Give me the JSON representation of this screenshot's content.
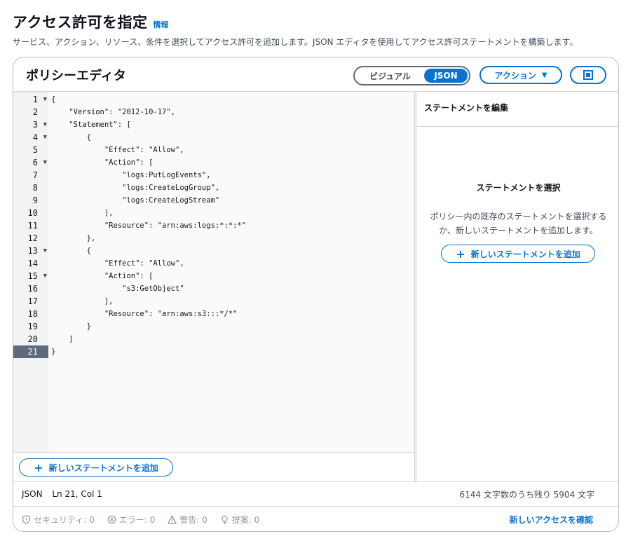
{
  "header": {
    "title": "アクセス許可を指定",
    "info": "情報",
    "description": "サービス、アクション、リソース、条件を選択してアクセス許可を追加します。JSON エディタを使用してアクセス許可ステートメントを構築します。"
  },
  "editor": {
    "title": "ポリシーエディタ",
    "mode_visual": "ビジュアル",
    "mode_json": "JSON",
    "actions_label": "アクション",
    "add_statement": "新しいステートメントを追加",
    "lines": [
      "{",
      "    \"Version\": \"2012-10-17\",",
      "    \"Statement\": [",
      "        {",
      "            \"Effect\": \"Allow\",",
      "            \"Action\": [",
      "                \"logs:PutLogEvents\",",
      "                \"logs:CreateLogGroup\",",
      "                \"logs:CreateLogStream\"",
      "            ],",
      "            \"Resource\": \"arn:aws:logs:*:*:*\"",
      "        },",
      "        {",
      "            \"Effect\": \"Allow\",",
      "            \"Action\": [",
      "                \"s3:GetObject\"",
      "            ],",
      "            \"Resource\": \"arn:aws:s3:::*/*\"",
      "        }",
      "    ]",
      "}"
    ],
    "line_numbers": [
      "1",
      "2",
      "3",
      "4",
      "5",
      "6",
      "7",
      "8",
      "9",
      "10",
      "11",
      "12",
      "13",
      "14",
      "15",
      "16",
      "17",
      "18",
      "19",
      "20",
      "21"
    ],
    "foldable_lines": [
      1,
      3,
      4,
      6,
      13,
      15
    ],
    "active_line": 21
  },
  "panel": {
    "title": "ステートメントを編集",
    "empty_title": "ステートメントを選択",
    "empty_desc": "ポリシー内の既存のステートメントを選択するか、新しいステートメントを追加します。",
    "add_statement": "新しいステートメントを追加"
  },
  "status": {
    "mode": "JSON",
    "position": "Ln 21, Col 1",
    "chars_remaining": "6144 文字数のうち残り 5904 文字"
  },
  "validation": {
    "security": "セキュリティ: 0",
    "errors": "エラー: 0",
    "warnings": "警告: 0",
    "suggestions": "提案: 0",
    "review": "新しいアクセスを確認"
  },
  "colors": {
    "accent": "#0972d3",
    "active_line_bg": "#5f6b7a",
    "muted": "#8d99a8"
  }
}
